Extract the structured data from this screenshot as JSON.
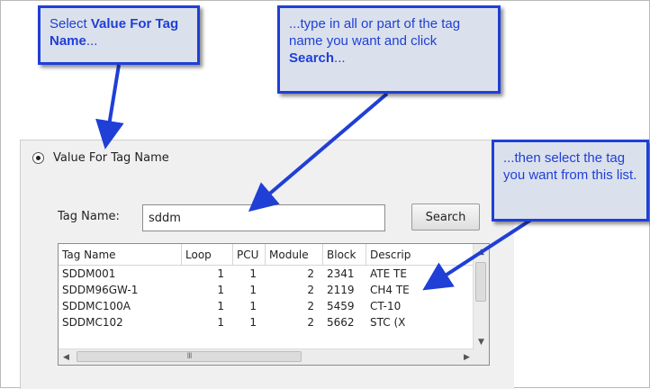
{
  "callouts": {
    "first": {
      "prefix": "Select ",
      "bold": "Value For Tag Name",
      "suffix": "..."
    },
    "second": {
      "prefix": "...type in all or part of the tag name you want and click ",
      "bold": "Search",
      "suffix": "..."
    },
    "third": {
      "text": "...then select the tag you want from this list."
    }
  },
  "radio": {
    "label": "Value For Tag Name",
    "checked": true
  },
  "tag_name": {
    "label": "Tag Name:",
    "value": "sddm"
  },
  "search_button": {
    "label": "Search"
  },
  "list": {
    "columns": [
      "Tag Name",
      "Loop",
      "PCU",
      "Module",
      "Block",
      "Descrip"
    ],
    "rows": [
      [
        "SDDM001",
        "1",
        "1",
        "2",
        "2341",
        "ATE TE"
      ],
      [
        "SDDM96GW-1",
        "1",
        "1",
        "2",
        "2119",
        "CH4 TE"
      ],
      [
        "SDDMC100A",
        "1",
        "1",
        "2",
        "5459",
        "CT-10"
      ],
      [
        "SDDMC102",
        "1",
        "1",
        "2",
        "5662",
        "STC (X"
      ]
    ],
    "hscroll_grip": "III"
  },
  "colors": {
    "callout_border": "#1f3fd6",
    "callout_fill": "#dbe1ec",
    "panel": "#f0f0f0"
  },
  "icons": [
    "scroll-up-arrow-icon",
    "scroll-down-arrow-icon",
    "scroll-left-arrow-icon",
    "scroll-right-arrow-icon"
  ]
}
